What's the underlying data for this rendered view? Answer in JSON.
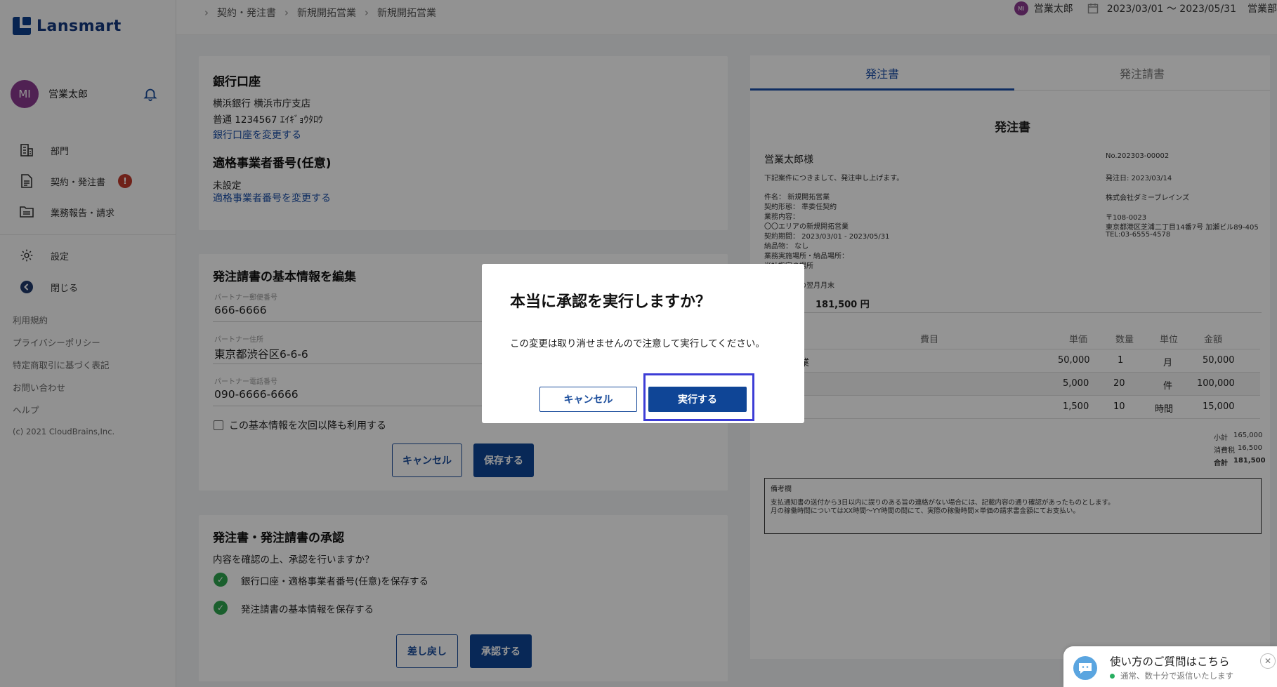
{
  "app": {
    "logo": "Lansmart"
  },
  "sidebar": {
    "avatar_initials": "MI",
    "user_name": "営業太郎",
    "nav": [
      {
        "label": "部門",
        "icon": "building-icon"
      },
      {
        "label": "契約・発注書",
        "icon": "document-icon",
        "badge": "!"
      },
      {
        "label": "業務報告・請求",
        "icon": "folder-icon"
      },
      {
        "label": "設定",
        "icon": "gear-icon"
      },
      {
        "label": "閉じる",
        "icon": "collapse-icon"
      }
    ],
    "footer_links": [
      "利用規約",
      "プライバシーポリシー",
      "特定商取引に基づく表記",
      "お問い合わせ",
      "ヘルプ"
    ],
    "copyright": "(c) 2021 CloudBrains,Inc."
  },
  "topbar": {
    "breadcrumbs": [
      "契約・発注書",
      "新規開拓営業",
      "新規開拓営業"
    ],
    "avatar_initials": "MI",
    "user_name": "営業太郎",
    "date_range": "2023/03/01 ～ 2023/05/31",
    "department": "営業部"
  },
  "bank": {
    "title": "銀行口座",
    "bank_line": "横浜銀行  横浜市庁支店",
    "account_line": "普通  1234567  ｴｲｷﾞｮｳﾀﾛｳ",
    "change_link": "銀行口座を変更する",
    "invoice_title": "適格事業者番号(任意)",
    "invoice_value": "未設定",
    "invoice_link": "適格事業者番号を変更する"
  },
  "edit": {
    "title": "発注請書の基本情報を編集",
    "fields": [
      {
        "label": "パートナー郵便番号",
        "value": "666-6666"
      },
      {
        "label": "パートナー住所",
        "value": "東京都渋谷区6-6-6"
      },
      {
        "label": "パートナー電話番号",
        "value": "090-6666-6666"
      }
    ],
    "checkbox_label": "この基本情報を次回以降も利用する",
    "cancel": "キャンセル",
    "save": "保存する"
  },
  "approval": {
    "title": "発注書・発注請書の承認",
    "question": "内容を確認の上、承認を行いますか？",
    "checks": [
      "銀行口座・適格事業者番号(任意)を保存する",
      "発注請書の基本情報を保存する"
    ],
    "reject": "差し戻し",
    "approve": "承認する"
  },
  "doc": {
    "tabs": [
      "発注書",
      "発注請書"
    ],
    "heading": "発注書",
    "addressee": "営業太郎様",
    "intro": "下記案件につきまして、発注申し上げます。",
    "details": [
      "件名：  新規開拓営業",
      "契約形態：  準委任契約",
      "業務内容：",
      "  〇〇エリアの新規開拓営業",
      "契約期間：  2023/03/01 - 2023/05/31",
      "納品物：  なし",
      "業務実施場所・納品場所：",
      "  当社指定の場所",
      "  月末",
      "  請求締め日の翌月月末"
    ],
    "number": "No.202303-00002",
    "issue_date": "発注日: 2023/03/14",
    "company": "株式会社ダミーブレインズ",
    "postal": "〒108-0023",
    "address": "東京都港区芝浦二丁目14番7号  加瀬ビル89-405",
    "tel": "TEL:03-6555-4578",
    "total_display": "181,500 円",
    "columns": [
      "費目",
      "単価",
      "数量",
      "単位",
      "金額"
    ],
    "rows": [
      {
        "item": "営業",
        "price": "50,000",
        "qty": "1",
        "unit": "月",
        "amount": "50,000"
      },
      {
        "item": "",
        "price": "5,000",
        "qty": "20",
        "unit": "件",
        "amount": "100,000"
      },
      {
        "item": "",
        "price": "1,500",
        "qty": "10",
        "unit": "時間",
        "amount": "15,000"
      }
    ],
    "summary": [
      {
        "label": "小計",
        "value": "165,000"
      },
      {
        "label": "消費税",
        "value": "16,500"
      },
      {
        "label": "合計",
        "value": "181,500"
      }
    ],
    "remarks_title": "備考欄",
    "remarks_lines": [
      "支払通知書の送付から3日以内に誤りのある旨の連絡がない場合には、記載内容の通り確認があったものとします。",
      "月の稼働時間についてはXX時間～YY時間の間にて、実際の稼働時間×単価の請求書金額にてお支払い。"
    ]
  },
  "modal": {
    "title": "本当に承認を実行しますか？",
    "message": "この変更は取り消せませんので注意して実行してください。",
    "cancel": "キャンセル",
    "confirm": "実行する"
  },
  "chat": {
    "title": "使い方のご質問はこちら",
    "subtitle": "通常、数十分で返信いたします"
  },
  "colors": {
    "primary": "#0f4596",
    "link": "#1a4fa8",
    "avatar": "#8b3a8f",
    "alert": "#c0392b",
    "success": "#2ea44f",
    "focus": "#3d3dd6"
  }
}
